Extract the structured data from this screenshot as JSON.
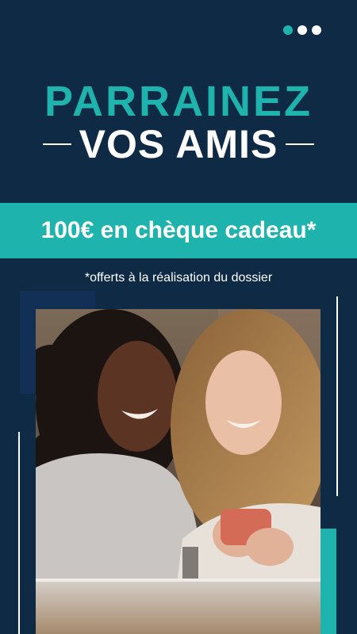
{
  "colors": {
    "background": "#0e2a45",
    "accent": "#1fb3ad",
    "text": "#ffffff"
  },
  "menu": {
    "icon": "more-dots-icon",
    "dots": [
      "#1fb3ad",
      "#ffffff",
      "#ffffff"
    ]
  },
  "headline": {
    "line1": "PARRAINEZ",
    "line2": "VOS AMIS"
  },
  "offer": {
    "text": "100€ en chèque cadeau*"
  },
  "footnote": {
    "text": "*offerts à la réalisation du dossier"
  },
  "photo": {
    "icon": "photo-two-women-smartphone"
  }
}
